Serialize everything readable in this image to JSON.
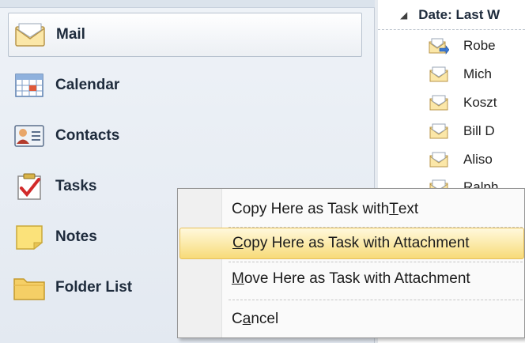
{
  "nav": {
    "items": [
      {
        "label": "Mail",
        "icon": "mail-icon",
        "selected": true
      },
      {
        "label": "Calendar",
        "icon": "calendar-icon"
      },
      {
        "label": "Contacts",
        "icon": "contacts-icon"
      },
      {
        "label": "Tasks",
        "icon": "tasks-icon"
      },
      {
        "label": "Notes",
        "icon": "notes-icon"
      },
      {
        "label": "Folder List",
        "icon": "folder-icon"
      }
    ]
  },
  "list": {
    "group_header": "Date: Last W",
    "rows": [
      {
        "sender": "Robe",
        "icon": "forwarded-mail-icon"
      },
      {
        "sender": "Mich",
        "icon": "read-mail-icon"
      },
      {
        "sender": "Koszt",
        "icon": "read-mail-icon"
      },
      {
        "sender": "Bill D",
        "icon": "read-mail-icon"
      },
      {
        "sender": "Aliso",
        "icon": "read-mail-icon"
      },
      {
        "sender": "Ralph",
        "icon": "read-mail-icon"
      }
    ]
  },
  "context_menu": {
    "items": [
      {
        "pre": "Copy Here as Task with ",
        "accel": "T",
        "post": "ext"
      },
      {
        "pre": "",
        "accel": "C",
        "post": "opy Here as Task with Attachment",
        "highlighted": true
      },
      {
        "pre": "",
        "accel": "M",
        "post": "ove Here as Task with Attachment"
      },
      {
        "pre": "C",
        "accel": "a",
        "post": "ncel"
      }
    ]
  },
  "colors": {
    "highlight": "#fbe9a6",
    "nav_background": "#e3e9f1",
    "menu_background": "#fafafa"
  }
}
